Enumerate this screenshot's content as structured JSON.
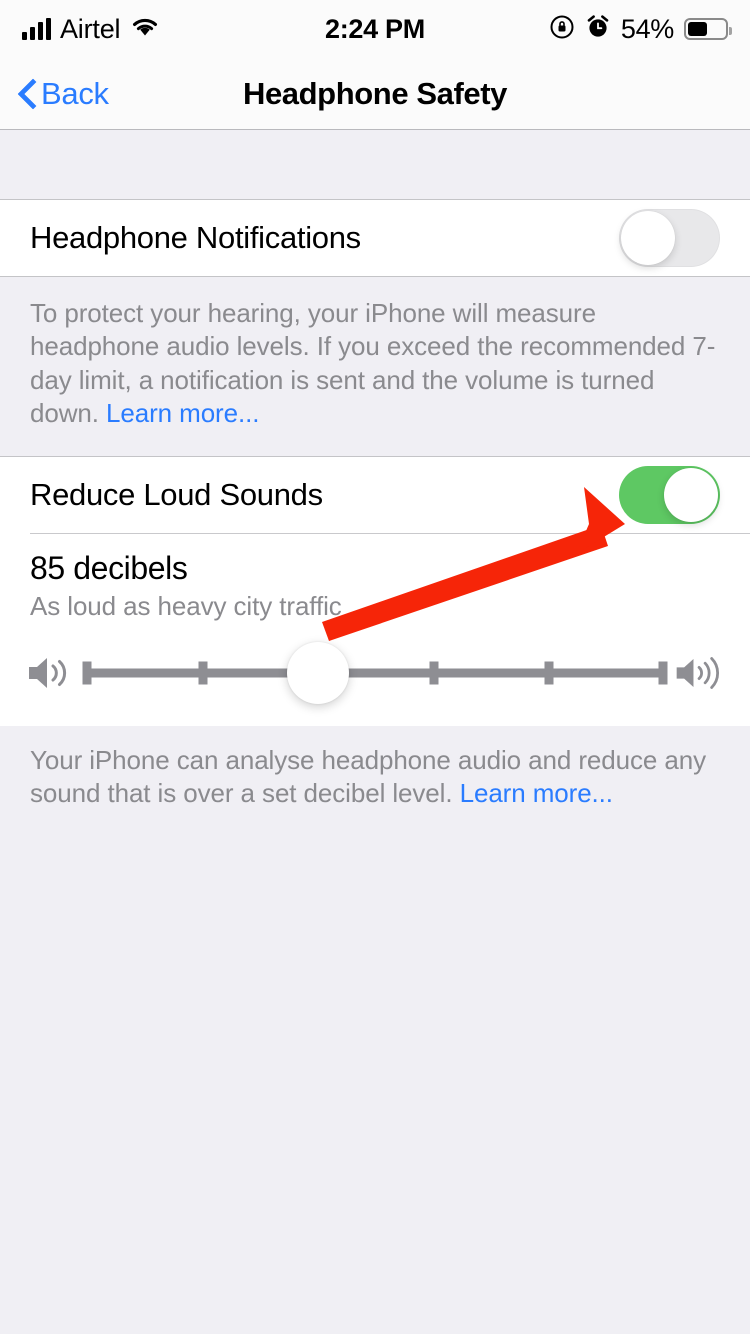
{
  "statusbar": {
    "carrier": "Airtel",
    "time": "2:24 PM",
    "battery_percent": "54%",
    "signal_icon": "cellular-bars-icon",
    "wifi_icon": "wifi-icon",
    "rotation_lock_icon": "rotation-lock-icon",
    "alarm_icon": "alarm-clock-icon",
    "battery_icon": "battery-icon"
  },
  "navbar": {
    "back_label": "Back",
    "back_icon": "chevron-left-icon",
    "title": "Headphone Safety"
  },
  "section_notifications": {
    "row_label": "Headphone Notifications",
    "toggle_state": "off",
    "footer_text": "To protect your hearing, your iPhone will measure headphone audio levels. If you exceed the recommended 7-day limit, a notification is sent and the volume is turned down. ",
    "footer_link": "Learn more..."
  },
  "section_reduce": {
    "row_label": "Reduce Loud Sounds",
    "toggle_state": "on",
    "decibel_value": "85 decibels",
    "decibel_subtitle": "As loud as heavy city traffic",
    "slider": {
      "low_icon": "speaker-low-volume-icon",
      "high_icon": "speaker-high-volume-icon",
      "value_index": 2,
      "tick_count": 6,
      "min_label": "",
      "max_label": ""
    },
    "footer_text": "Your iPhone can analyse headphone audio and reduce any sound that is over a set decibel level. ",
    "footer_link": "Learn more..."
  },
  "annotation": {
    "arrow_icon": "red-arrow-annotation",
    "color": "#f62508",
    "points_at": "reduce-loud-sounds-toggle"
  },
  "colors": {
    "accent_blue": "#2a7cff",
    "toggle_on_green": "#5ec863",
    "toggle_off_gray": "#e8e8ea",
    "group_background": "#f0eff4",
    "cell_background": "#ffffff",
    "secondary_text": "#8a8a8e",
    "separator": "#c4c4c7"
  }
}
